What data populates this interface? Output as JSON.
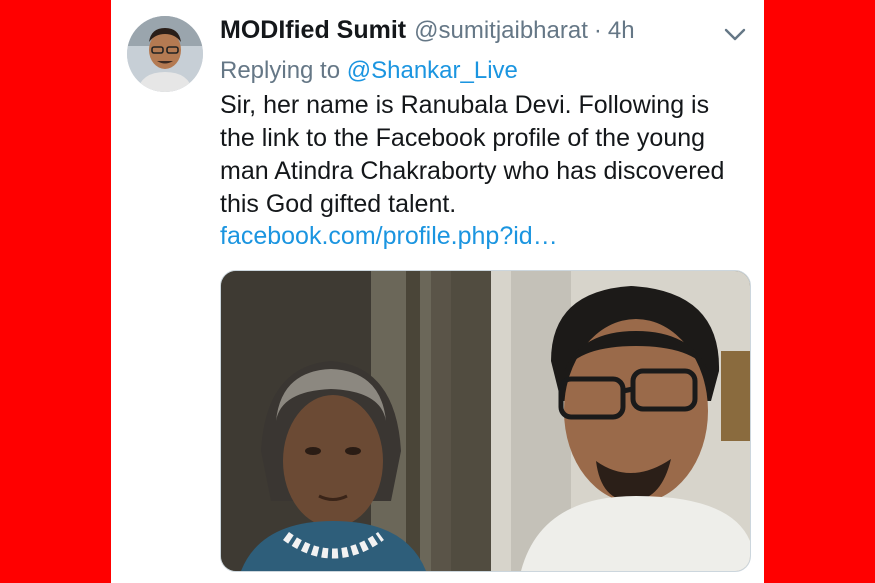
{
  "tweet": {
    "author_name": "MODIfied Sumit",
    "author_handle": "@sumitjaibharat",
    "separator": "·",
    "time": "4h",
    "replying_prefix": "Replying to",
    "replying_to": "@Shankar_Live",
    "text": "Sir, her name is Ranubala Devi. Following is the link to the Facebook profile of the young man Atindra Chakraborty who has discovered this God gifted talent.",
    "link": "facebook.com/profile.php?id…"
  },
  "icons": {
    "menu": "chevron-down-icon"
  },
  "colors": {
    "background": "#ff0000",
    "card": "#ffffff",
    "text": "#14171a",
    "secondary": "#657786",
    "link": "#1b95e0"
  }
}
